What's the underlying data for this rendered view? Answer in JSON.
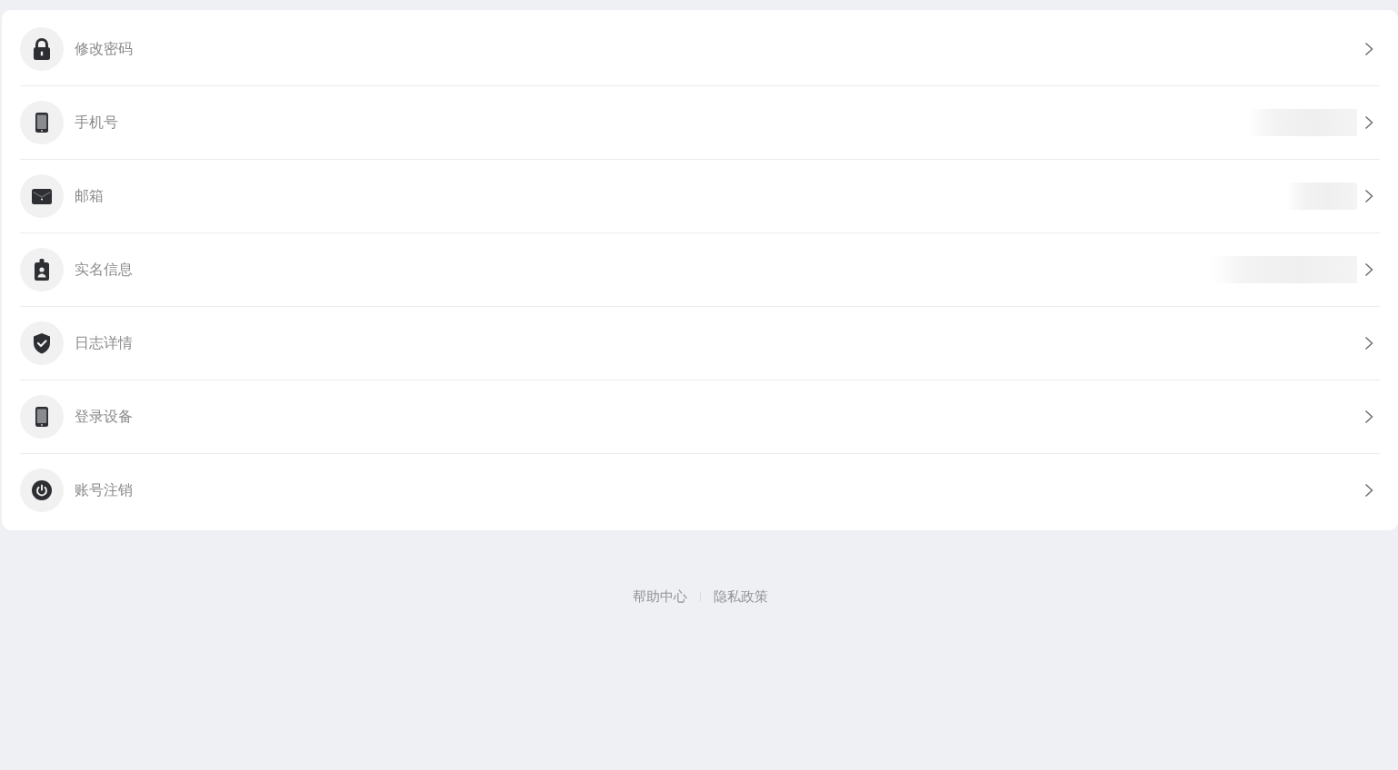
{
  "settings": {
    "items": [
      {
        "label": "修改密码",
        "masked": false
      },
      {
        "label": "手机号",
        "masked": true
      },
      {
        "label": "邮箱",
        "masked": true
      },
      {
        "label": "实名信息",
        "masked": true
      },
      {
        "label": "日志详情",
        "masked": false
      },
      {
        "label": "登录设备",
        "masked": false
      },
      {
        "label": "账号注销",
        "masked": false
      }
    ]
  },
  "footer": {
    "links": [
      "帮助中心",
      "隐私政策"
    ]
  }
}
